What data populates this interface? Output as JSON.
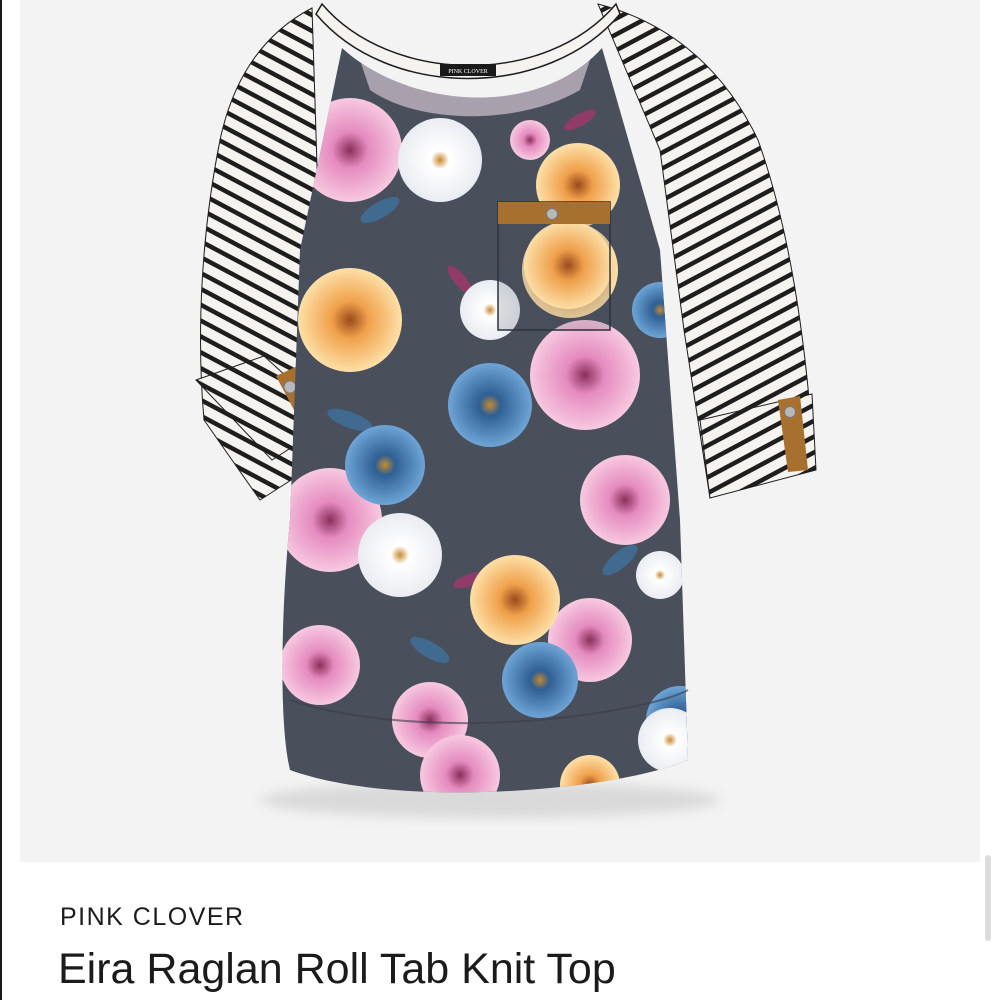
{
  "product": {
    "brand": "PINK CLOVER",
    "name": "Eira Raglan Roll Tab Knit Top",
    "label_text": "PINK CLOVER"
  },
  "colors": {
    "panel_background": "#f3f3f3",
    "body_charcoal": "#4a4f5c",
    "stripe_dark": "#1e1e1e",
    "stripe_light": "#f5f3ef",
    "tab_tan": "#a8702f",
    "flower_pink": "#d66aa8",
    "flower_peach": "#f2b566",
    "flower_blue": "#3d78b0",
    "text": "#1b1b1b"
  },
  "icons": {
    "tab_button": "button-icon"
  }
}
